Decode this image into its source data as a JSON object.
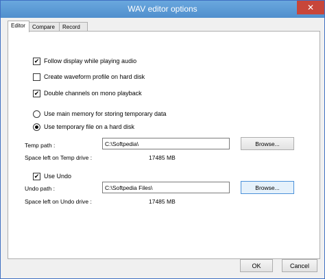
{
  "window": {
    "title": "WAV editor options",
    "close_glyph": "✕"
  },
  "tabs": [
    {
      "label": "Editor",
      "active": true
    },
    {
      "label": "Compare",
      "active": false
    },
    {
      "label": "Record",
      "active": false
    }
  ],
  "options": {
    "follow_display": {
      "label": "Follow display while playing audio",
      "checked": true
    },
    "waveform_profile": {
      "label": "Create waveform profile on hard disk",
      "checked": false
    },
    "double_channels": {
      "label": "Double channels on mono playback",
      "checked": true
    }
  },
  "storage": {
    "main_memory": {
      "label": "Use main memory for storing temporary data",
      "selected": false
    },
    "temp_file": {
      "label": "Use temporary file on a hard disk",
      "selected": true
    }
  },
  "temp": {
    "path_label": "Temp path :",
    "path_value": "C:\\Softpedia\\",
    "browse_label": "Browse...",
    "space_label": "Space left on Temp drive :",
    "space_value": "17485 MB"
  },
  "undo": {
    "use_label": "Use Undo",
    "use_checked": true,
    "path_label": "Undo path :",
    "path_value": "C:\\Softpedia Files\\",
    "browse_label": "Browse...",
    "space_label": "Space left on Undo drive :",
    "space_value": "17485 MB"
  },
  "footer": {
    "ok_label": "OK",
    "cancel_label": "Cancel"
  },
  "icons": {
    "check_glyph": "✔"
  }
}
